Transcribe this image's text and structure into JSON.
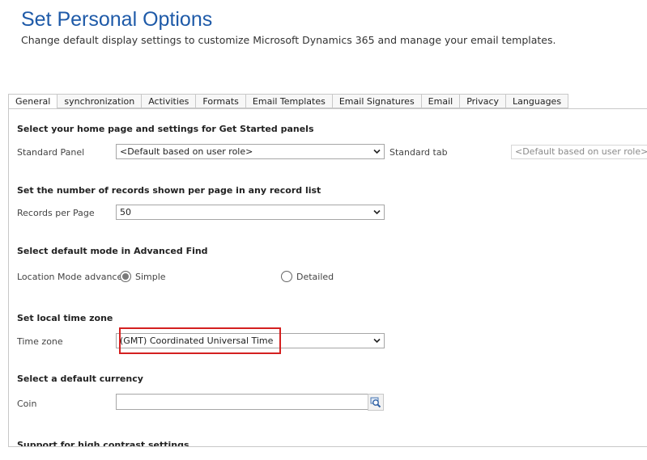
{
  "header": {
    "title": "Set Personal Options",
    "subtitle": "Change default display settings to customize Microsoft Dynamics 365 and manage your email templates."
  },
  "tabs": [
    {
      "label": "General",
      "active": true
    },
    {
      "label": "synchronization"
    },
    {
      "label": "Activities"
    },
    {
      "label": "Formats"
    },
    {
      "label": "Email Templates"
    },
    {
      "label": "Email Signatures"
    },
    {
      "label": "Email"
    },
    {
      "label": "Privacy"
    },
    {
      "label": "Languages"
    }
  ],
  "sections": {
    "home": {
      "title": "Select your home page and settings for Get Started panels",
      "panel_label": "Standard Panel",
      "panel_value": "<Default based on user role>",
      "tab_label": "Standard tab",
      "tab_value": "<Default based on user role>"
    },
    "records": {
      "title": "Set the number of records shown per page in any record list",
      "label": "Records per Page",
      "value": "50"
    },
    "advanced_find": {
      "title": "Select default mode in Advanced Find",
      "label": "Location Mode advance",
      "option_simple": "Simple",
      "option_detailed": "Detailed",
      "selected": "Simple"
    },
    "timezone": {
      "title": "Set local time zone",
      "label": "Time zone",
      "value": "(GMT) Coordinated Universal Time"
    },
    "currency": {
      "title": "Select a default currency",
      "label": "Coin",
      "value": ""
    },
    "contrast": {
      "title": "Support for high contrast settings"
    }
  },
  "colors": {
    "title": "#1e5aa8",
    "highlight": "#d42020"
  }
}
